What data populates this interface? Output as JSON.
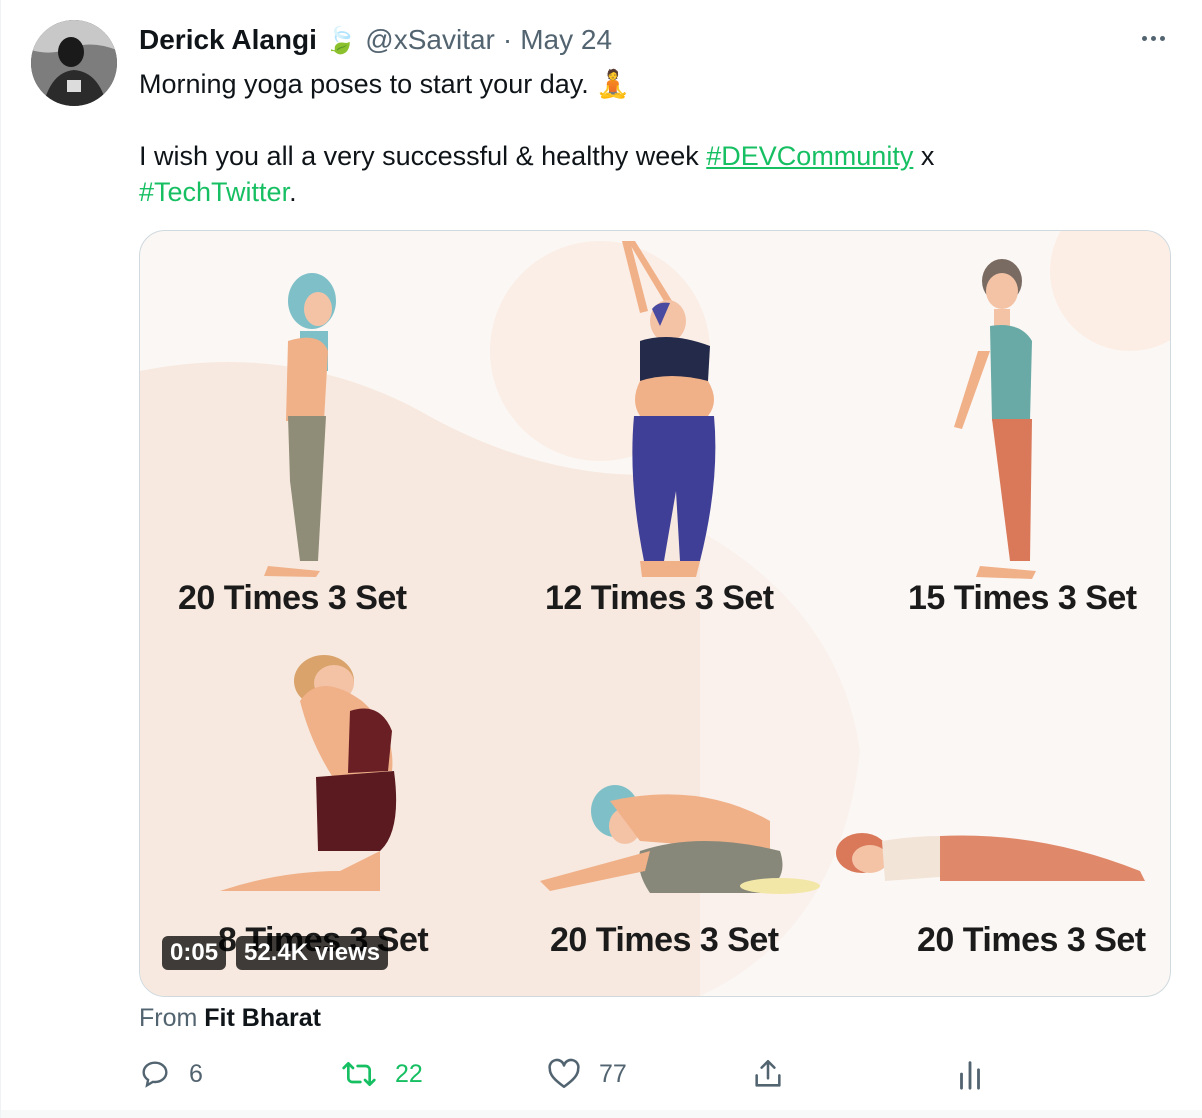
{
  "tweet": {
    "author_name": "Derick Alangi",
    "author_emoji": "🍃",
    "handle": "@xSavitar",
    "separator": "·",
    "date": "May 24",
    "text_line1": "Morning yoga poses to start your day.",
    "text_line1_emoji": "🧘",
    "text_line2_prefix": "I wish you all a very successful & healthy week ",
    "hashtag1": "#DEVCommunity",
    "text_line2_mid": " x",
    "hashtag2": "#TechTwitter",
    "text_line3_suffix": "."
  },
  "media": {
    "poses": [
      {
        "label": "20 Times 3 Set"
      },
      {
        "label": "12 Times 3 Set"
      },
      {
        "label": "15 Times 3 Set"
      },
      {
        "label": "8 Times 3 Set"
      },
      {
        "label": "20 Times 3 Set"
      },
      {
        "label": "20 Times 3 Set"
      }
    ],
    "duration": "0:05",
    "views": "52.4K views"
  },
  "source": {
    "prefix": "From",
    "name": "Fit Bharat"
  },
  "actions": {
    "reply_count": "6",
    "retweet_count": "22",
    "like_count": "77"
  },
  "colors": {
    "hashtag": "#17bf63",
    "muted": "#536471",
    "retweet_active": "#17bf63"
  },
  "icons": [
    "reply-icon",
    "retweet-icon",
    "like-icon",
    "share-icon",
    "analytics-icon",
    "more-icon",
    "leaf-icon"
  ]
}
